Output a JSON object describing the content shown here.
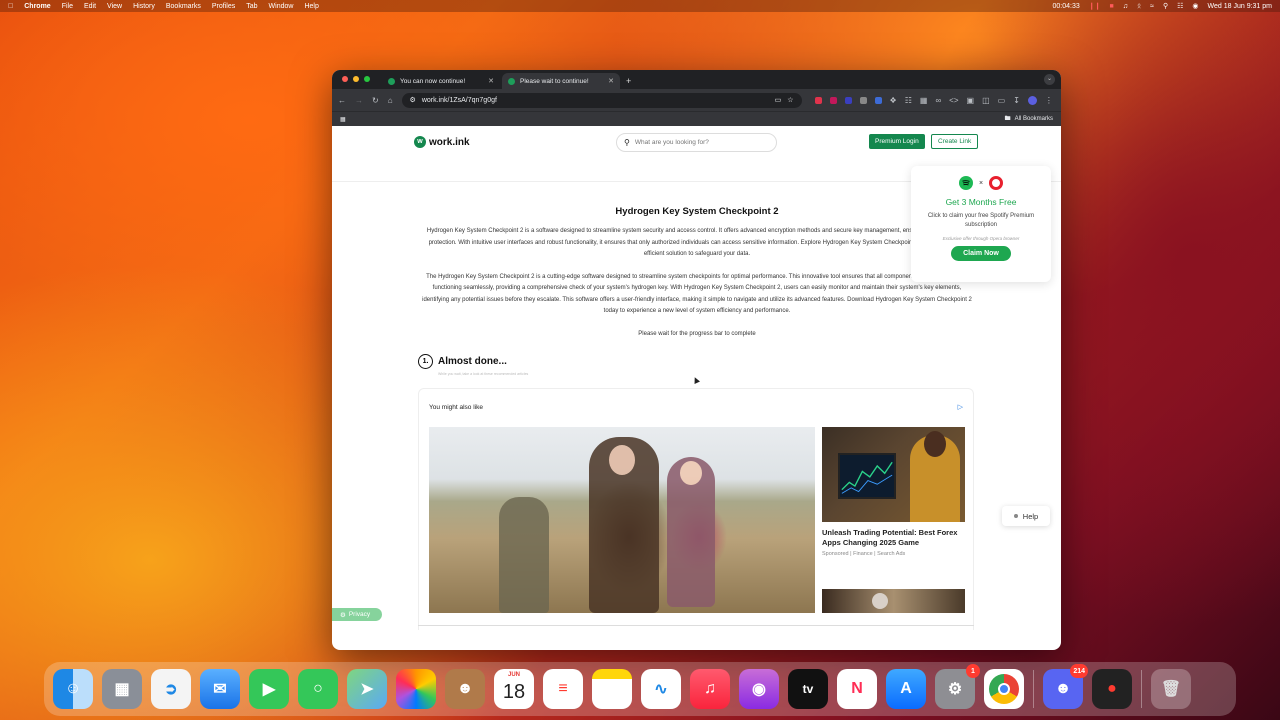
{
  "menubar": {
    "app": "Chrome",
    "items": [
      "File",
      "Edit",
      "View",
      "History",
      "Bookmarks",
      "Profiles",
      "Tab",
      "Window",
      "Help"
    ],
    "timer": "00:04:33",
    "datetime": "Wed 18 Jun  9:31 pm"
  },
  "browser": {
    "tabs": [
      {
        "title": "You can now continue!",
        "active": false
      },
      {
        "title": "Please wait to continue!",
        "active": true
      }
    ],
    "url": "work.ink/1ZsA/7qn7g0gf",
    "bookmarks_label": "All Bookmarks"
  },
  "site": {
    "logo": "work.ink",
    "search_placeholder": "What are you looking for?",
    "premium_login": "Premium Login",
    "create_link": "Create Link"
  },
  "article": {
    "title": "Hydrogen Key System Checkpoint 2",
    "para1": "Hydrogen Key System Checkpoint 2 is a software designed to streamline system security and access control. It offers advanced encryption methods and secure key management, ensuring enhanced data protection. With intuitive user interfaces and robust functionality, it ensures that only authorized individuals can access sensitive information. Explore Hydrogen Key System Checkpoint 2 for a reliable and efficient solution to safeguard your data.",
    "para2": "The Hydrogen Key System Checkpoint 2 is a cutting-edge software designed to streamline system checkpoints for optimal performance. This innovative tool ensures that all components of your system are functioning seamlessly, providing a comprehensive check of your system's hydrogen key. With Hydrogen Key System Checkpoint 2, users can easily monitor and maintain their system's key elements, identifying any potential issues before they escalate. This software offers a user-friendly interface, making it simple to navigate and utilize its advanced features. Download Hydrogen Key System Checkpoint 2 today to experience a new level of system efficiency and performance.",
    "wait_text": "Please wait for the progress bar to complete"
  },
  "step": {
    "number": "1.",
    "label": "Almost done...",
    "sub": "While you wait, take a look at these recommended articles"
  },
  "ads": {
    "heading": "You might also like",
    "side_title": "Unleash Trading Potential: Best Forex Apps Changing 2025 Game",
    "side_sub": "Sponsored | Finance | Search Ads"
  },
  "promo": {
    "title": "Get 3 Months Free",
    "desc": "Click to claim your free Spotify Premium subscription",
    "exclusive": "Exclusive offer through Opera browser",
    "claim": "Claim Now",
    "separator": "×"
  },
  "help_label": "Help",
  "privacy_label": "Privacy",
  "dock": {
    "calendar_month": "JUN",
    "calendar_day": "18",
    "settings_badge": "1",
    "discord_badge": "214"
  }
}
